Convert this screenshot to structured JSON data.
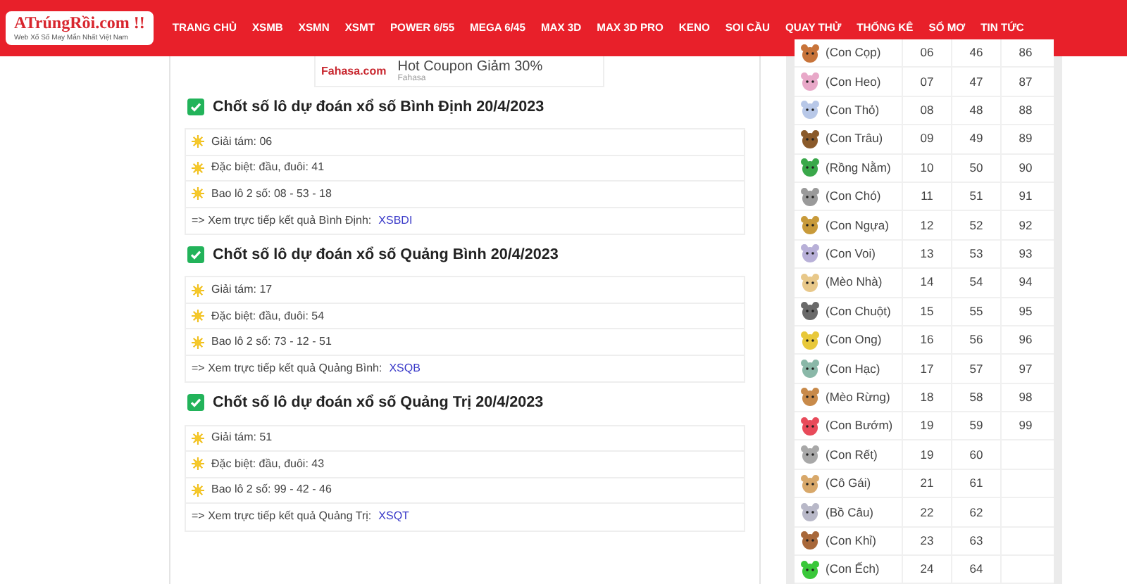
{
  "logo": {
    "name": "ATrúngRồi.com !!",
    "tagline": "Web Xổ Số May Mắn Nhất Việt Nam"
  },
  "nav": [
    {
      "label": "TRANG CHỦ"
    },
    {
      "label": "XSMB"
    },
    {
      "label": "XSMN"
    },
    {
      "label": "XSMT"
    },
    {
      "label": "POWER 6/55"
    },
    {
      "label": "MEGA 6/45"
    },
    {
      "label": "MAX 3D"
    },
    {
      "label": "MAX 3D PRO"
    },
    {
      "label": "KENO"
    },
    {
      "label": "SOI CẦU"
    },
    {
      "label": "QUAY THỬ"
    },
    {
      "label": "THỐNG KÊ"
    },
    {
      "label": "SỔ MƠ"
    },
    {
      "label": "TIN TỨC"
    }
  ],
  "ad": {
    "brand": "Fahasa.com",
    "title": "Hot Coupon Giảm 30%",
    "source": "Fahasa"
  },
  "sections": [
    {
      "title": "Chốt số lô dự đoán xổ số Bình Định 20/4/2023",
      "items": [
        "Giải tám: 06",
        "Đặc biệt: đầu, đuôi: 41",
        "Bao lô 2 số: 08 - 53 - 18"
      ],
      "link_text": "=> Xem trực tiếp kết quả Bình Định:",
      "link": "XSBDI"
    },
    {
      "title": "Chốt số lô dự đoán xổ số Quảng Bình 20/4/2023",
      "items": [
        "Giải tám: 17",
        "Đặc biệt: đầu, đuôi: 54",
        "Bao lô 2 số: 73 - 12 - 51"
      ],
      "link_text": "=> Xem trực tiếp kết quả Quảng Bình:",
      "link": "XSQB"
    },
    {
      "title": "Chốt số lô dự đoán xổ số Quảng Trị 20/4/2023",
      "items": [
        "Giải tám: 51",
        "Đặc biệt: đầu, đuôi: 43",
        "Bao lô 2 số: 99 - 42 - 46"
      ],
      "link_text": "=> Xem trực tiếp kết quả Quảng Trị:",
      "link": "XSQT"
    }
  ],
  "dream_table": [
    {
      "name": "(Con Cọp)",
      "numbers": [
        "06",
        "46",
        "86"
      ],
      "color": "#c8743a"
    },
    {
      "name": "(Con Heo)",
      "numbers": [
        "07",
        "47",
        "87"
      ],
      "color": "#e8a8c8"
    },
    {
      "name": "(Con Thỏ)",
      "numbers": [
        "08",
        "48",
        "88"
      ],
      "color": "#b8c8e8"
    },
    {
      "name": "(Con Trâu)",
      "numbers": [
        "09",
        "49",
        "89"
      ],
      "color": "#8a5a2a"
    },
    {
      "name": "(Rồng Nằm)",
      "numbers": [
        "10",
        "50",
        "90"
      ],
      "color": "#3aa84a"
    },
    {
      "name": "(Con Chó)",
      "numbers": [
        "11",
        "51",
        "91"
      ],
      "color": "#9a9a9a"
    },
    {
      "name": "(Con Ngựa)",
      "numbers": [
        "12",
        "52",
        "92"
      ],
      "color": "#c89a3a"
    },
    {
      "name": "(Con Voi)",
      "numbers": [
        "13",
        "53",
        "93"
      ],
      "color": "#b8b0d8"
    },
    {
      "name": "(Mèo Nhà)",
      "numbers": [
        "14",
        "54",
        "94"
      ],
      "color": "#e8c88a"
    },
    {
      "name": "(Con Chuột)",
      "numbers": [
        "15",
        "55",
        "95"
      ],
      "color": "#6a6a6a"
    },
    {
      "name": "(Con Ong)",
      "numbers": [
        "16",
        "56",
        "96"
      ],
      "color": "#e8c83a"
    },
    {
      "name": "(Con Hạc)",
      "numbers": [
        "17",
        "57",
        "97"
      ],
      "color": "#8ab8a8"
    },
    {
      "name": "(Mèo Rừng)",
      "numbers": [
        "18",
        "58",
        "98"
      ],
      "color": "#c88a4a"
    },
    {
      "name": "(Con Bướm)",
      "numbers": [
        "19",
        "59",
        "99"
      ],
      "color": "#e84a5a"
    },
    {
      "name": "(Con Rết)",
      "numbers": [
        "19",
        "60"
      ],
      "color": "#a8a8a8"
    },
    {
      "name": "(Cô Gái)",
      "numbers": [
        "21",
        "61"
      ],
      "color": "#d8a86a"
    },
    {
      "name": "(Bồ Câu)",
      "numbers": [
        "22",
        "62"
      ],
      "color": "#b8b8c8"
    },
    {
      "name": "(Con Khỉ)",
      "numbers": [
        "23",
        "63"
      ],
      "color": "#a8683a"
    },
    {
      "name": "(Con Ếch)",
      "numbers": [
        "24",
        "64"
      ],
      "color": "#3ac83a"
    }
  ]
}
